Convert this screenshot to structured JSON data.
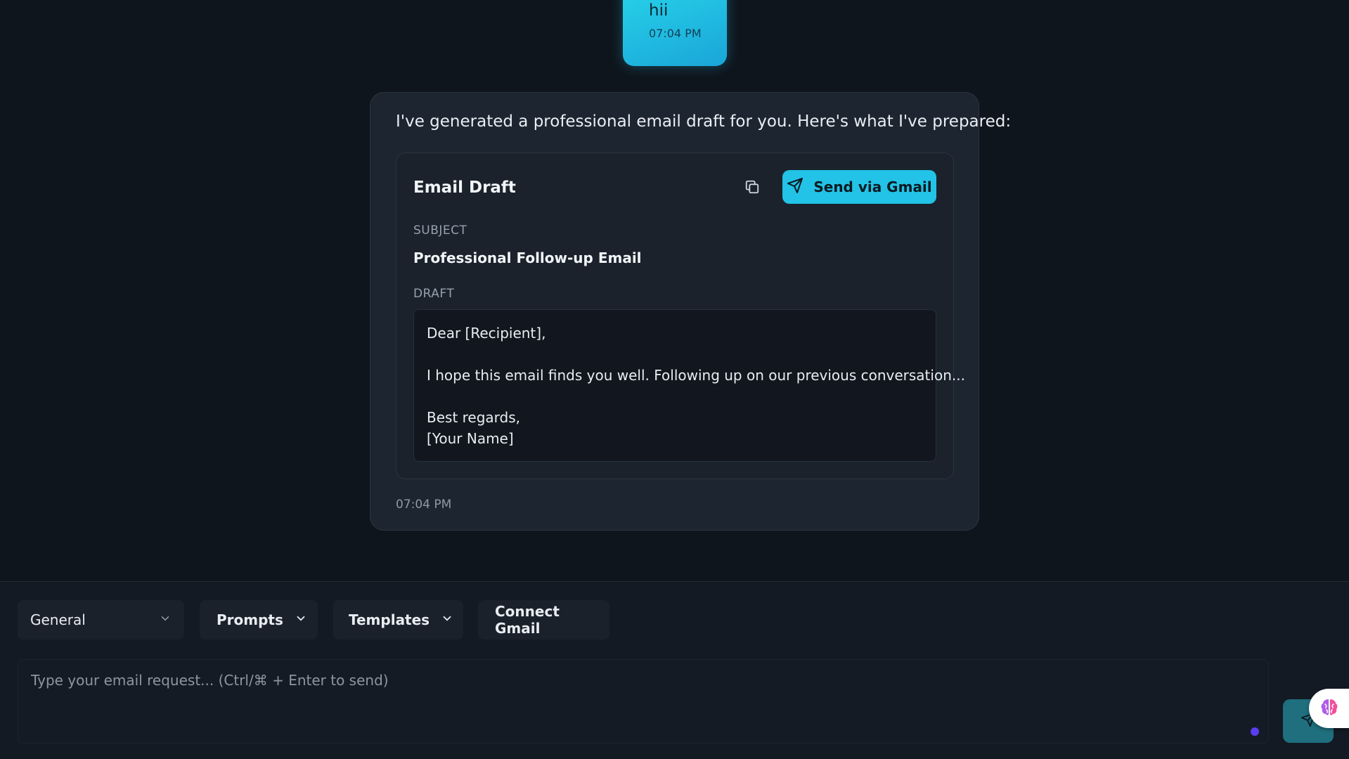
{
  "user_message": {
    "text": "hii",
    "time": "07:04 PM"
  },
  "assistant_message": {
    "intro": "I've generated a professional email draft for you. Here's what I've prepared:",
    "time": "07:04 PM",
    "draft_card": {
      "title": "Email Draft",
      "copy_icon": "copy-icon",
      "send_button_label": "Send via Gmail",
      "send_icon": "paper-plane-icon",
      "subject_label": "SUBJECT",
      "subject": "Professional Follow-up Email",
      "draft_label": "DRAFT",
      "body_lines": [
        "Dear [Recipient],",
        "",
        "I hope this email finds you well. Following up on our previous conversation...",
        "",
        "Best regards,",
        "[Your Name]"
      ]
    }
  },
  "toolbar": {
    "category_select": "General",
    "prompts_label": "Prompts",
    "templates_label": "Templates",
    "connect_gmail_label": "Connect Gmail"
  },
  "composer": {
    "placeholder": "Type your email request... (Ctrl/⌘ + Enter to send)",
    "value": ""
  },
  "colors": {
    "accent": "#22c3e6",
    "background": "#0f151c",
    "card": "#1d2530",
    "status_dot": "#5b3df0"
  },
  "icons": {
    "send": "paper-plane-icon",
    "badge": "brain-icon",
    "chevron": "chevron-down-icon"
  }
}
